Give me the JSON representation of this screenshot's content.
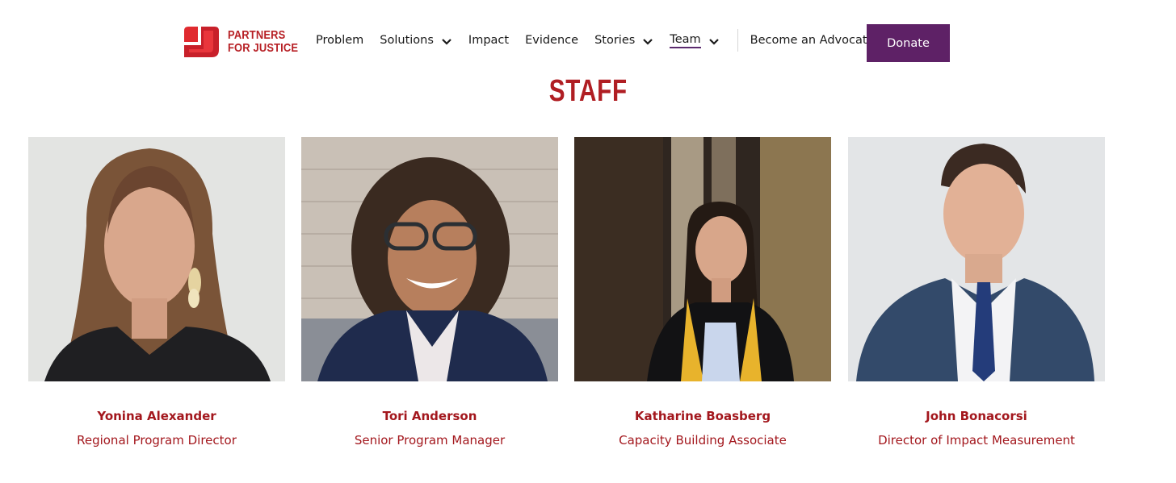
{
  "header": {
    "logo": {
      "line1": "PARTNERS",
      "line2": "FOR JUSTICE"
    },
    "nav": [
      {
        "label": "Problem",
        "dropdown": false,
        "active": false
      },
      {
        "label": "Solutions",
        "dropdown": true,
        "active": false
      },
      {
        "label": "Impact",
        "dropdown": false,
        "active": false
      },
      {
        "label": "Evidence",
        "dropdown": false,
        "active": false
      },
      {
        "label": "Stories",
        "dropdown": true,
        "active": false
      },
      {
        "label": "Team",
        "dropdown": true,
        "active": true
      }
    ],
    "advocate_label": "Become an Advocate",
    "donate_label": "Donate"
  },
  "section": {
    "title": "STAFF"
  },
  "staff": [
    {
      "name": "Yonina Alexander",
      "role": "Regional Program Director"
    },
    {
      "name": "Tori Anderson",
      "role": "Senior Program Manager"
    },
    {
      "name": "Katharine Boasberg",
      "role": "Capacity Building Associate"
    },
    {
      "name": "John Bonacorsi",
      "role": "Director of Impact Measurement"
    }
  ],
  "colors": {
    "brand_red": "#b01e23",
    "donate_purple": "#5e2166",
    "text": "#1a1a1a"
  }
}
